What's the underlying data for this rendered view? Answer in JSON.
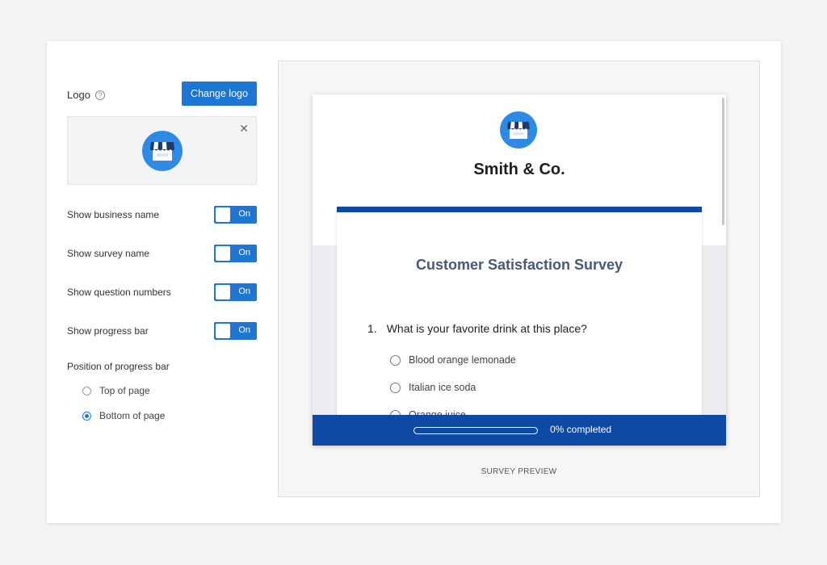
{
  "settings": {
    "logo_label": "Logo",
    "help_icon": "?",
    "change_logo_label": "Change logo",
    "remove_logo_icon": "✕",
    "toggles": [
      {
        "label": "Show business name",
        "state": "On"
      },
      {
        "label": "Show survey name",
        "state": "On"
      },
      {
        "label": "Show question numbers",
        "state": "On"
      },
      {
        "label": "Show progress bar",
        "state": "On"
      }
    ],
    "progress_position": {
      "title": "Position of progress bar",
      "options": [
        {
          "label": "Top of page",
          "selected": false
        },
        {
          "label": "Bottom of page",
          "selected": true
        }
      ]
    }
  },
  "preview": {
    "caption": "SURVEY PREVIEW",
    "business_name": "Smith & Co.",
    "survey_title": "Customer Satisfaction Survey",
    "question_number": "1.",
    "question_text": "What is your favorite drink at this place?",
    "answers": [
      "Blood orange lemonade",
      "Italian ice soda",
      "Orange juice"
    ],
    "progress_fraction": 0,
    "progress_text": "0% completed"
  },
  "colors": {
    "accent": "#1c76d2",
    "survey_accent": "#0f49a6",
    "title_color": "#465a78"
  }
}
